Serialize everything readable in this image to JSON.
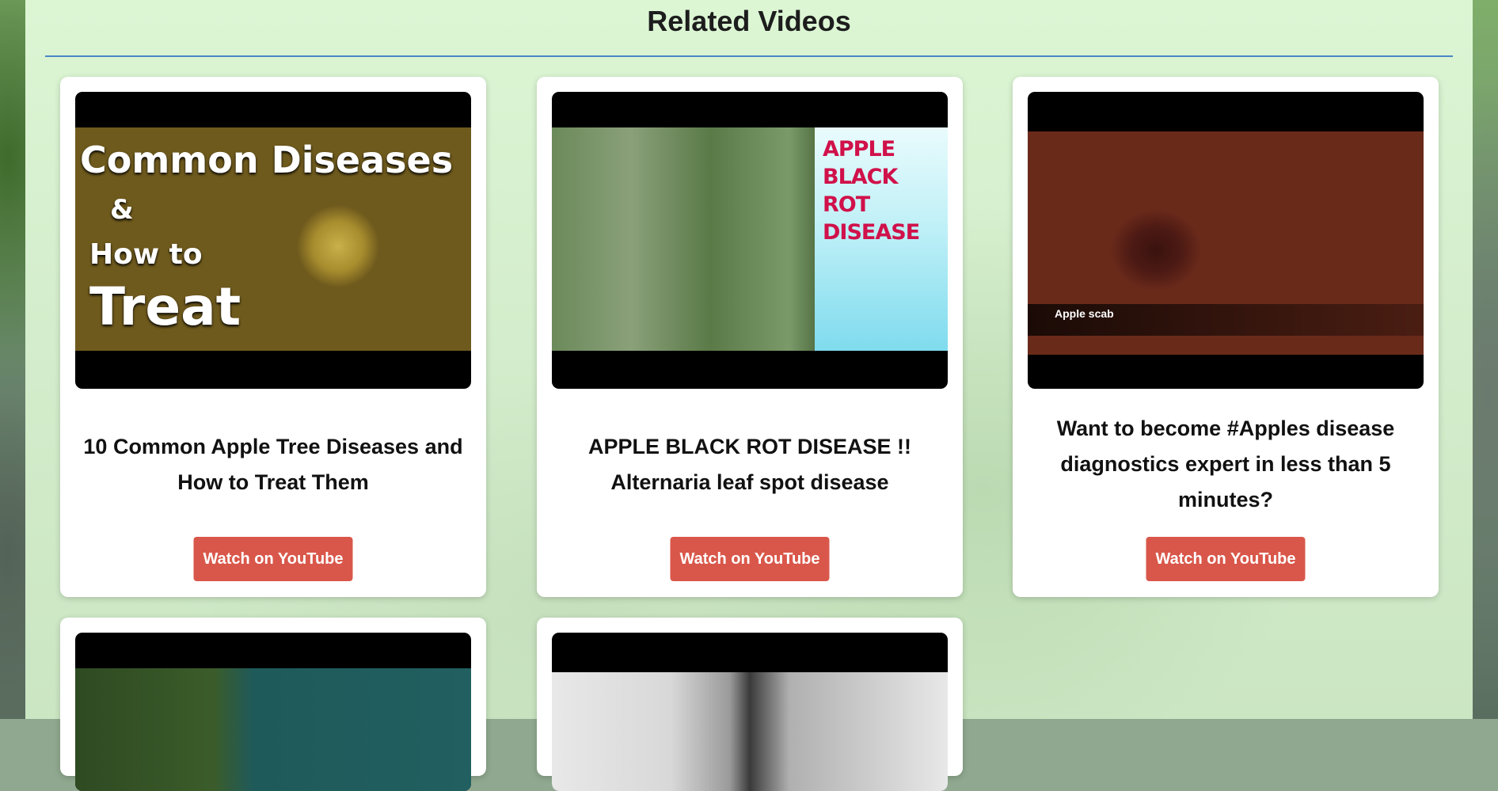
{
  "section": {
    "heading": "Related Videos"
  },
  "videos": [
    {
      "title": "10 Common Apple Tree Diseases and How to Treat Them",
      "button": "Watch on YouTube",
      "thumbnail_text": [
        "Common Diseases",
        "&",
        "How to",
        "Treat"
      ]
    },
    {
      "title": "APPLE BLACK ROT DISEASE !! Alternaria leaf spot disease",
      "button": "Watch on YouTube",
      "thumbnail_text": [
        "APPLE",
        "BLACK",
        "ROT",
        "DISEASE"
      ]
    },
    {
      "title": "Want to become #Apples disease diagnostics expert in less than 5 minutes?",
      "button": "Watch on YouTube",
      "thumbnail_text": [
        "Apple scab"
      ]
    },
    {
      "title": "",
      "button": ""
    },
    {
      "title": "",
      "button": ""
    }
  ],
  "colors": {
    "button": "#d9574a",
    "divider": "#4a86c5",
    "panel": "#d9f3d1"
  }
}
